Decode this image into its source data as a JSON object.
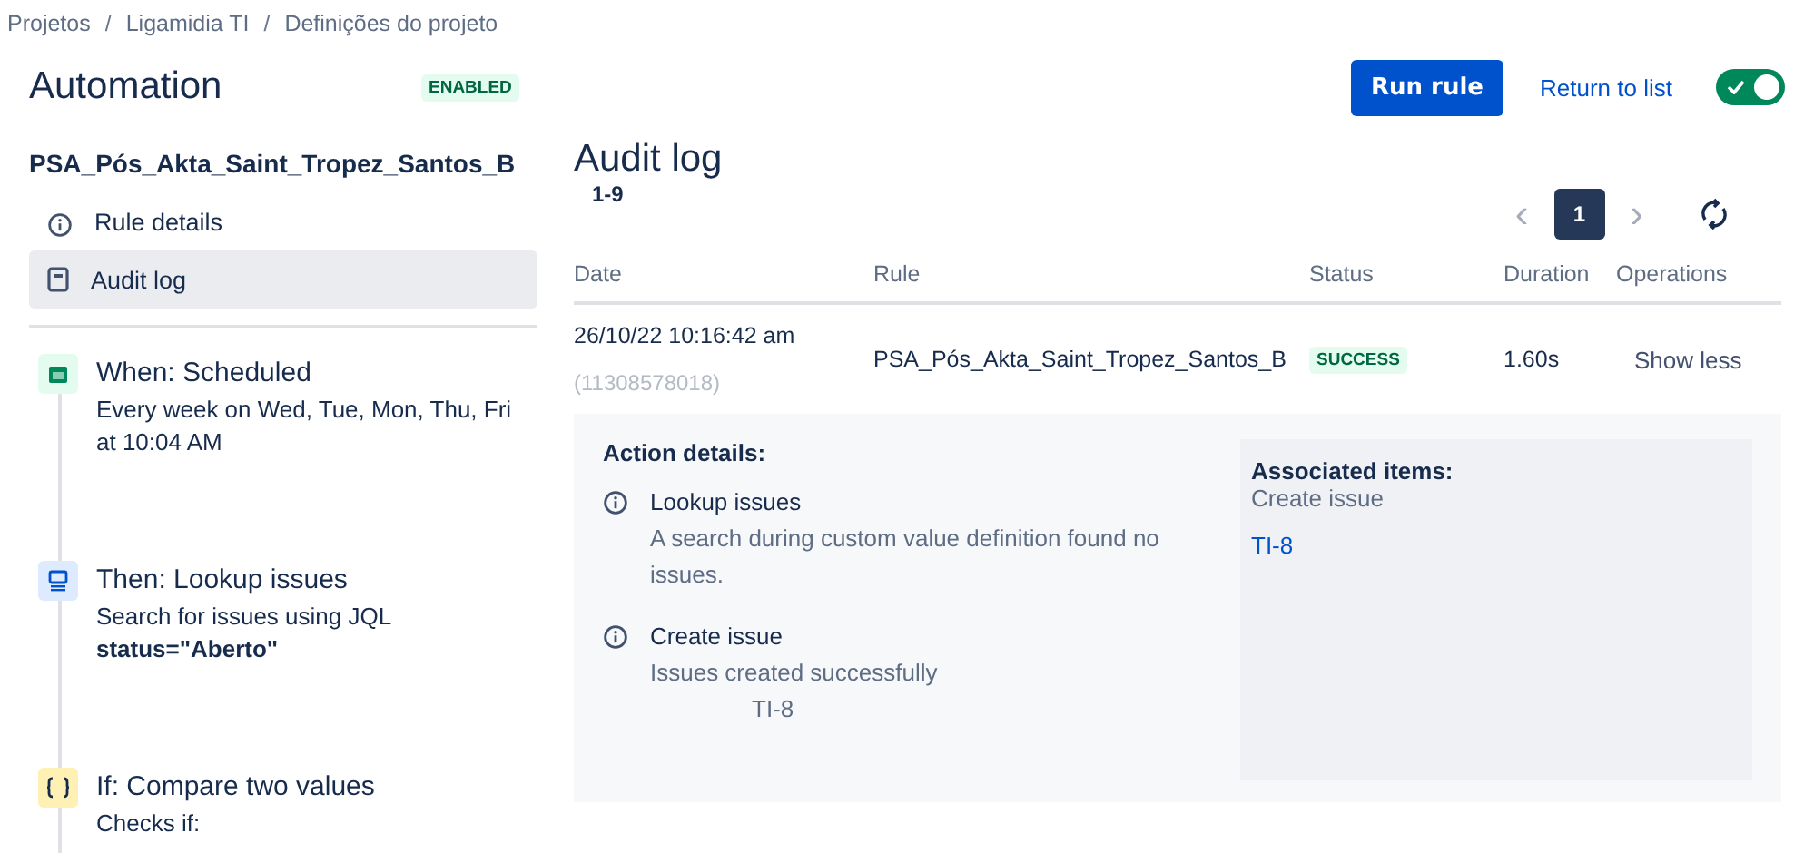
{
  "breadcrumbs": {
    "separator": "/",
    "items": [
      "Projetos",
      "Ligamidia TI",
      "Definições do projeto"
    ]
  },
  "header": {
    "title": "Automation",
    "status_badge": "ENABLED",
    "run_button": "Run rule",
    "return_link": "Return to list",
    "rule_enabled": true
  },
  "sidebar": {
    "rule_name": "PSA_Pós_Akta_Saint_Tropez_Santos_B",
    "nav": [
      {
        "label": "Rule details",
        "selected": false
      },
      {
        "label": "Audit log",
        "selected": true
      }
    ],
    "steps": [
      {
        "kind": "trigger",
        "title": "When: Scheduled",
        "lines": [
          "Every week on Wed, Tue, Mon, Thu, Fri",
          "at 10:04 AM"
        ]
      },
      {
        "kind": "action",
        "title": "Then: Lookup issues",
        "lines": [
          "Search for issues using JQL",
          "**status=\"Aberto\"**"
        ]
      },
      {
        "kind": "condition",
        "title": "If: Compare two values",
        "lines": [
          "Checks if:"
        ]
      }
    ]
  },
  "audit": {
    "title": "Audit log",
    "range": "1-9",
    "pagination": {
      "prev": "‹",
      "next": "›",
      "pages": [
        {
          "label": "1",
          "selected": true
        }
      ]
    },
    "columns": [
      "Date",
      "Rule",
      "Status",
      "Duration",
      "Operations"
    ],
    "rows": [
      {
        "date": "26/10/22 10:16:42 am",
        "id": "(11308578018)",
        "rule": "PSA_Pós_Akta_Saint_Tropez_Santos_B",
        "status": "SUCCESS",
        "duration": "1.60s",
        "operation": "Show less",
        "expanded": true,
        "details": {
          "title": "Action details:",
          "actions": [
            {
              "name": "Lookup issues",
              "message": "A search during custom value definition found no issues."
            },
            {
              "name": "Create issue",
              "message": "Issues created successfully",
              "item": "TI-8"
            }
          ],
          "associated": {
            "title": "Associated items:",
            "groups": [
              {
                "name": "Create issue",
                "links": [
                  "TI-8"
                ]
              }
            ]
          }
        }
      }
    ]
  }
}
